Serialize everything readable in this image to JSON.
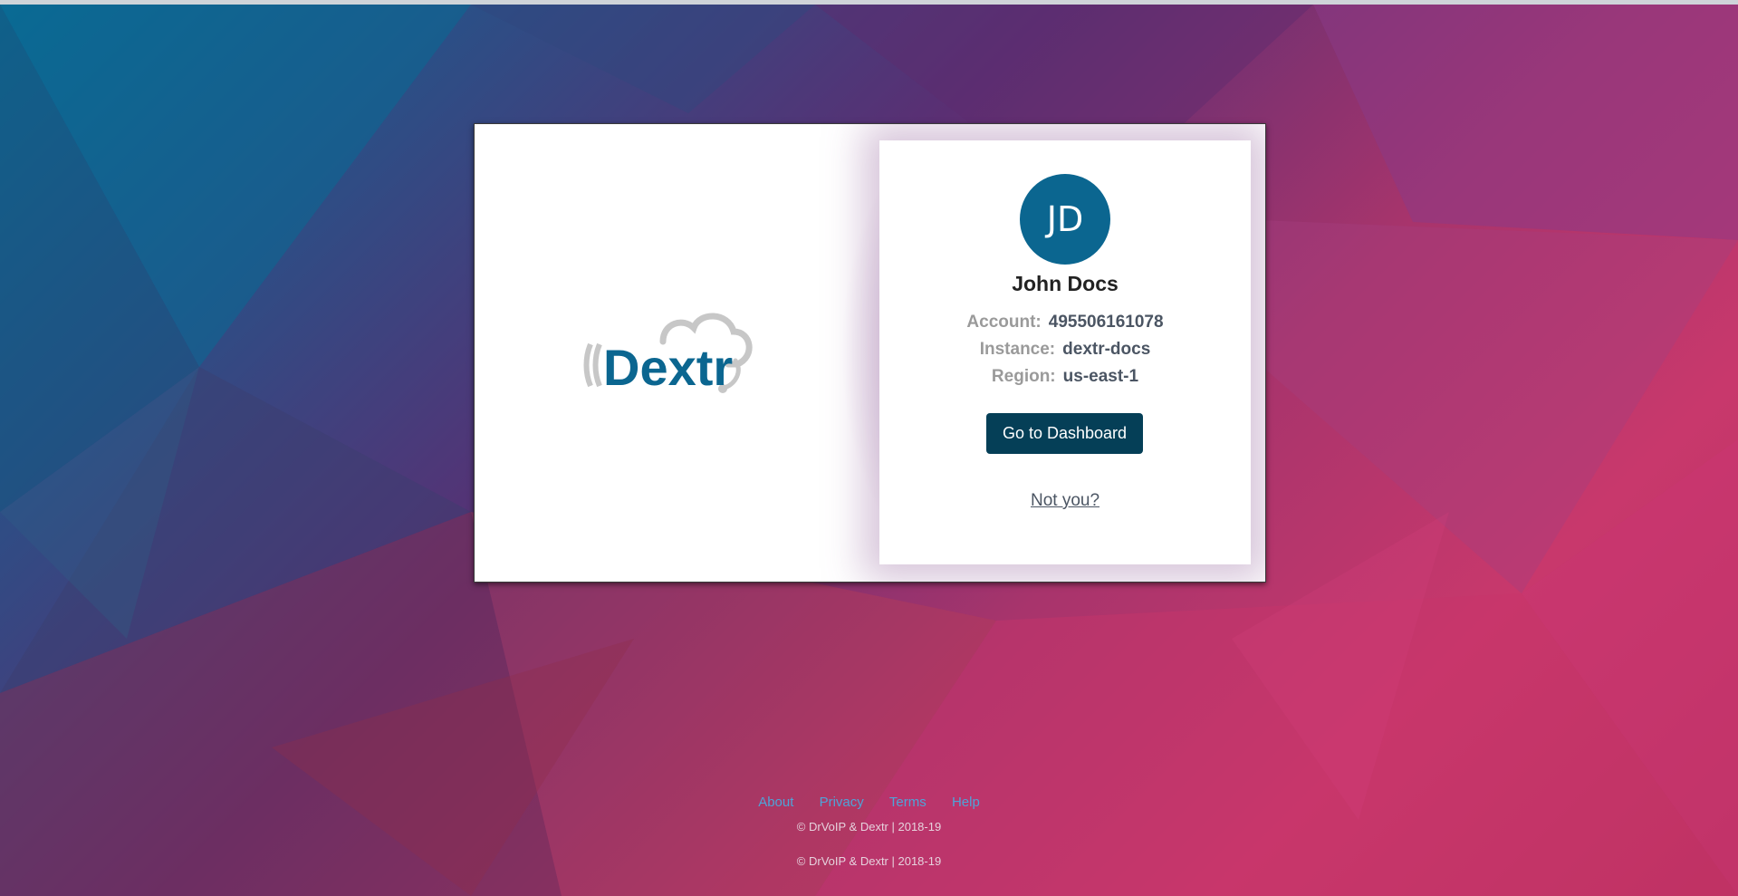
{
  "user": {
    "initials": "JD",
    "name": "John Docs"
  },
  "details": {
    "account_label": "Account:",
    "account_value": "495506161078",
    "instance_label": "Instance:",
    "instance_value": "dextr-docs",
    "region_label": "Region:",
    "region_value": "us-east-1"
  },
  "actions": {
    "dashboard_label": "Go to Dashboard",
    "not_you_label": "Not you?"
  },
  "logo": {
    "text": "Dextr"
  },
  "footer": {
    "links": [
      "About",
      "Privacy",
      "Terms",
      "Help"
    ],
    "copyright_1": "© DrVoIP & Dextr | 2018-19",
    "copyright_2": "© DrVoIP & Dextr | 2018-19"
  },
  "colors": {
    "accent": "#0b6690",
    "button": "#053f57",
    "link": "#4fa3d8"
  }
}
